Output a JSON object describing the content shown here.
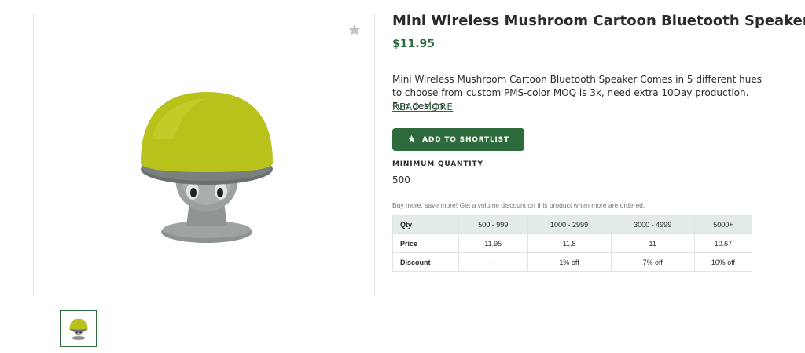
{
  "product": {
    "title": "Mini Wireless Mushroom Cartoon Bluetooth Speaker",
    "price": "$11.95",
    "description": "Mini Wireless Mushroom Cartoon Bluetooth Speaker Comes in 5 different hues to choose from custom PMS-color MOQ is 3k, need extra 10Day production. Fun design.",
    "read_more": "READ MORE",
    "shortlist_label": "ADD TO SHORTLIST",
    "min_qty_label": "MINIMUM QUANTITY",
    "min_qty_value": "500",
    "volume_note": "Buy more, save more! Get a volume discount on this product when more are ordered."
  },
  "pricing_table": {
    "header": [
      "Qty",
      "500 - 999",
      "1000 - 2999",
      "3000 - 4999",
      "5000+"
    ],
    "price_row": [
      "Price",
      "11.95",
      "11.8",
      "11",
      "10.67"
    ],
    "discount_row": [
      "Discount",
      "--",
      "1% off",
      "7% off",
      "10% off"
    ]
  },
  "icons": {
    "favorite": "star-icon",
    "shortlist": "star-icon"
  },
  "colors": {
    "accent": "#2e6b3c",
    "table_header_bg": "#e3ebe6",
    "product_cap": "#b9c21b",
    "product_body": "#8e9494"
  }
}
